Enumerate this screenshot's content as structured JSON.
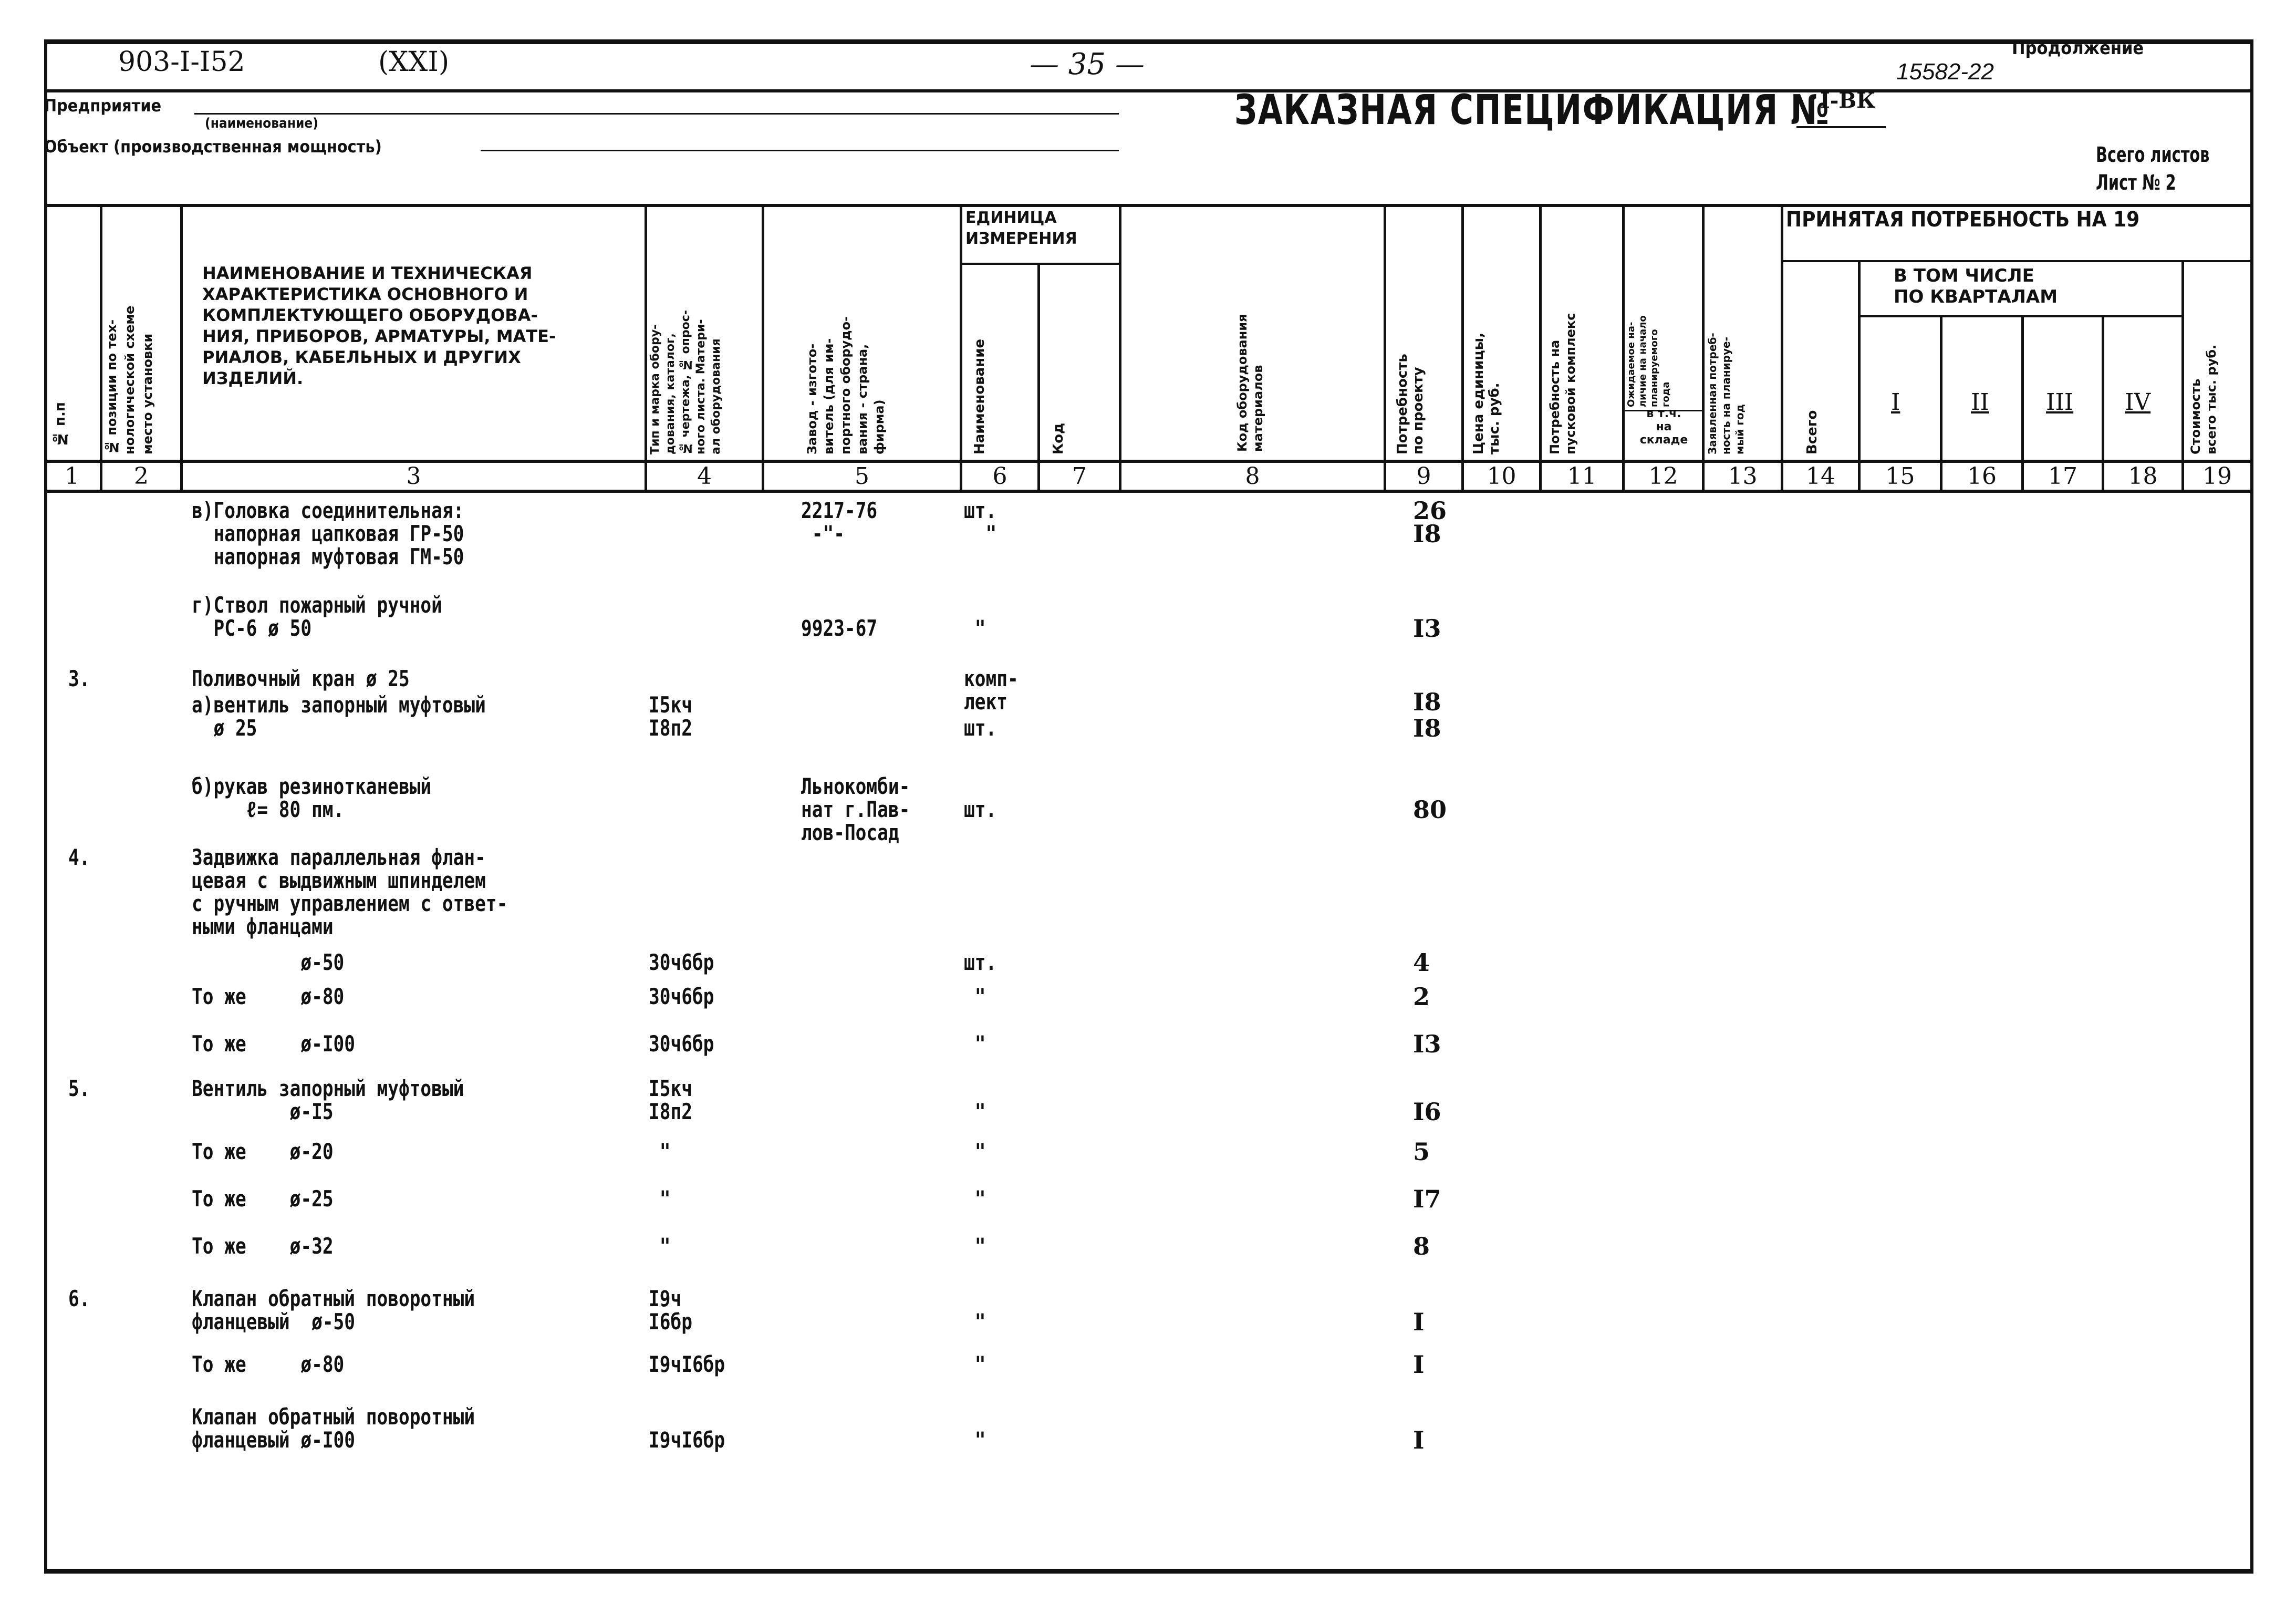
{
  "sheet_header": {
    "project_code": "903-I-I52",
    "volume": "(XXI)",
    "page": "— 35 —",
    "continuation": "Продолжение",
    "inventory_no": "15582-22"
  },
  "form": {
    "enterprise_label": "Предприятие",
    "enterprise_sublabel": "(наименование)",
    "object_label": "Объект  (производственная мощность)",
    "title": "ЗАКАЗНАЯ СПЕЦИФИКАЦИЯ №",
    "spec_number": "I-ВК",
    "total_sheets_label": "Всего листов",
    "sheet_label": "Лист № 2"
  },
  "columns": [
    {
      "num": "1",
      "header": "№ п.п"
    },
    {
      "num": "2",
      "header": "№ позиции по тех-\nнологической схеме\nместо установки"
    },
    {
      "num": "3",
      "header": "НАИМЕНОВАНИЕ И ТЕХНИЧЕСКАЯ\nХАРАКТЕРИСТИКА ОСНОВНОГО И\nКОМПЛЕКТУЮЩЕГО ОБОРУДОВА-\nНИЯ, ПРИБОРОВ, АРМАТУРЫ, МАТЕ-\nРИАЛОВ, КАБЕЛЬНЫХ И ДРУГИХ\nИЗДЕЛИЙ."
    },
    {
      "num": "4",
      "header": "Тип и марка обору-\nдования, каталог,\n№ чертежа, № опрос-\nного листа. Матери-\nал оборудования"
    },
    {
      "num": "5",
      "header": "Завод - изгото-\nвитель (для им-\nпортного оборудо-\nвания - страна,\nфирма)"
    },
    {
      "num": "6",
      "header": "Наименование"
    },
    {
      "num": "7",
      "header": "Код"
    },
    {
      "num": "8",
      "header": "Код оборудования\nматериалов"
    },
    {
      "num": "9",
      "header": "Потребность\nпо проекту"
    },
    {
      "num": "10",
      "header": "Цена единицы,\nтыс. руб."
    },
    {
      "num": "11",
      "header": "Потребность на\nпусковой комплекс"
    },
    {
      "num": "12",
      "header": "Ожидаемое на-\nличие на начало\nпланируемого\nгода"
    },
    {
      "num": "12b",
      "header": "в т.ч.\nна\nскладе"
    },
    {
      "num": "13",
      "header": "Заявленная потреб-\nность на планируе-\nмый год"
    },
    {
      "num": "14",
      "header": "Всего"
    },
    {
      "num": "15",
      "header": "I"
    },
    {
      "num": "16",
      "header": "II"
    },
    {
      "num": "17",
      "header": "III"
    },
    {
      "num": "18",
      "header": "IV"
    },
    {
      "num": "19",
      "header": "Стоимость\nвсего тыс. руб."
    }
  ],
  "group_headers": {
    "unit": "ЕДИНИЦА\nИЗМЕРЕНИЯ",
    "accepted": "ПРИНЯТАЯ ПОТРЕБНОСТЬ НА 19",
    "by_quarter": "В ТОМ   ЧИСЛЕ\nПО  КВАРТАЛАМ"
  },
  "rows": [
    {
      "pos": "",
      "name": "в)Головка соединительная:\n  напорная цапковая ГР-50\n  напорная муфтовая ГМ-50",
      "type": "",
      "maker": "2217-76\n -\"-",
      "unit": "шт.\n  \"",
      "qty": "26\nI8"
    },
    {
      "pos": "",
      "name": "г)Ствол пожарный ручной\n  РС-6 ø 50",
      "type": "",
      "maker": "\n9923-67",
      "unit": "\n \"",
      "qty": "\nI3"
    },
    {
      "pos": "3.",
      "name": "Поливочный кран ø 25",
      "type": "",
      "maker": "",
      "unit": "комп-\nлект",
      "qty": "\nI8"
    },
    {
      "pos": "",
      "name": "а)вентиль запорный муфтовый\n  ø 25",
      "type": "I5кч\nI8п2",
      "maker": "",
      "unit": "\nшт.",
      "qty": "\nI8"
    },
    {
      "pos": "",
      "name": "б)рукав резинотканевый\n     ℓ= 80 пм.",
      "type": "",
      "maker": "Льнокомби-\nнат г.Пав-\nлов-Посад",
      "unit": "\nшт.",
      "qty": "\n80"
    },
    {
      "pos": "4.",
      "name": "Задвижка параллельная флан-\nцевая с выдвижным шпинделем\nс ручным управлением с ответ-\nными фланцами",
      "type": "",
      "maker": "",
      "unit": "",
      "qty": ""
    },
    {
      "pos": "",
      "name": "          ø-50",
      "type": "30ч6бр",
      "maker": "",
      "unit": "шт.",
      "qty": "4"
    },
    {
      "pos": "",
      "name": "То же     ø-80",
      "type": "30ч6бр",
      "maker": "",
      "unit": " \"",
      "qty": "2"
    },
    {
      "pos": "",
      "name": "То же     ø-I00",
      "type": "30ч6бр",
      "maker": "",
      "unit": " \"",
      "qty": "I3"
    },
    {
      "pos": "5.",
      "name": "Вентиль запорный муфтовый\n         ø-I5",
      "type": "I5кч\nI8п2",
      "maker": "",
      "unit": "\n \"",
      "qty": "\nI6"
    },
    {
      "pos": "",
      "name": "То же    ø-20",
      "type": " \"",
      "maker": "",
      "unit": " \"",
      "qty": "5"
    },
    {
      "pos": "",
      "name": "То же    ø-25",
      "type": " \"",
      "maker": "",
      "unit": " \"",
      "qty": "I7"
    },
    {
      "pos": "",
      "name": "То же    ø-32",
      "type": " \"",
      "maker": "",
      "unit": " \"",
      "qty": "8"
    },
    {
      "pos": "6.",
      "name": "Клапан обратный поворотный\nфланцевый  ø-50",
      "type": "I9ч\nI6бр",
      "maker": "",
      "unit": "\n \"",
      "qty": "\nI"
    },
    {
      "pos": "",
      "name": "То же     ø-80",
      "type": "I9чI6бр",
      "maker": "",
      "unit": " \"",
      "qty": "I"
    },
    {
      "pos": "",
      "name": "Клапан обратный поворотный\nфланцевый ø-I00",
      "type": "\nI9чI6бр",
      "maker": "",
      "unit": "\n \"",
      "qty": "\nI"
    }
  ]
}
